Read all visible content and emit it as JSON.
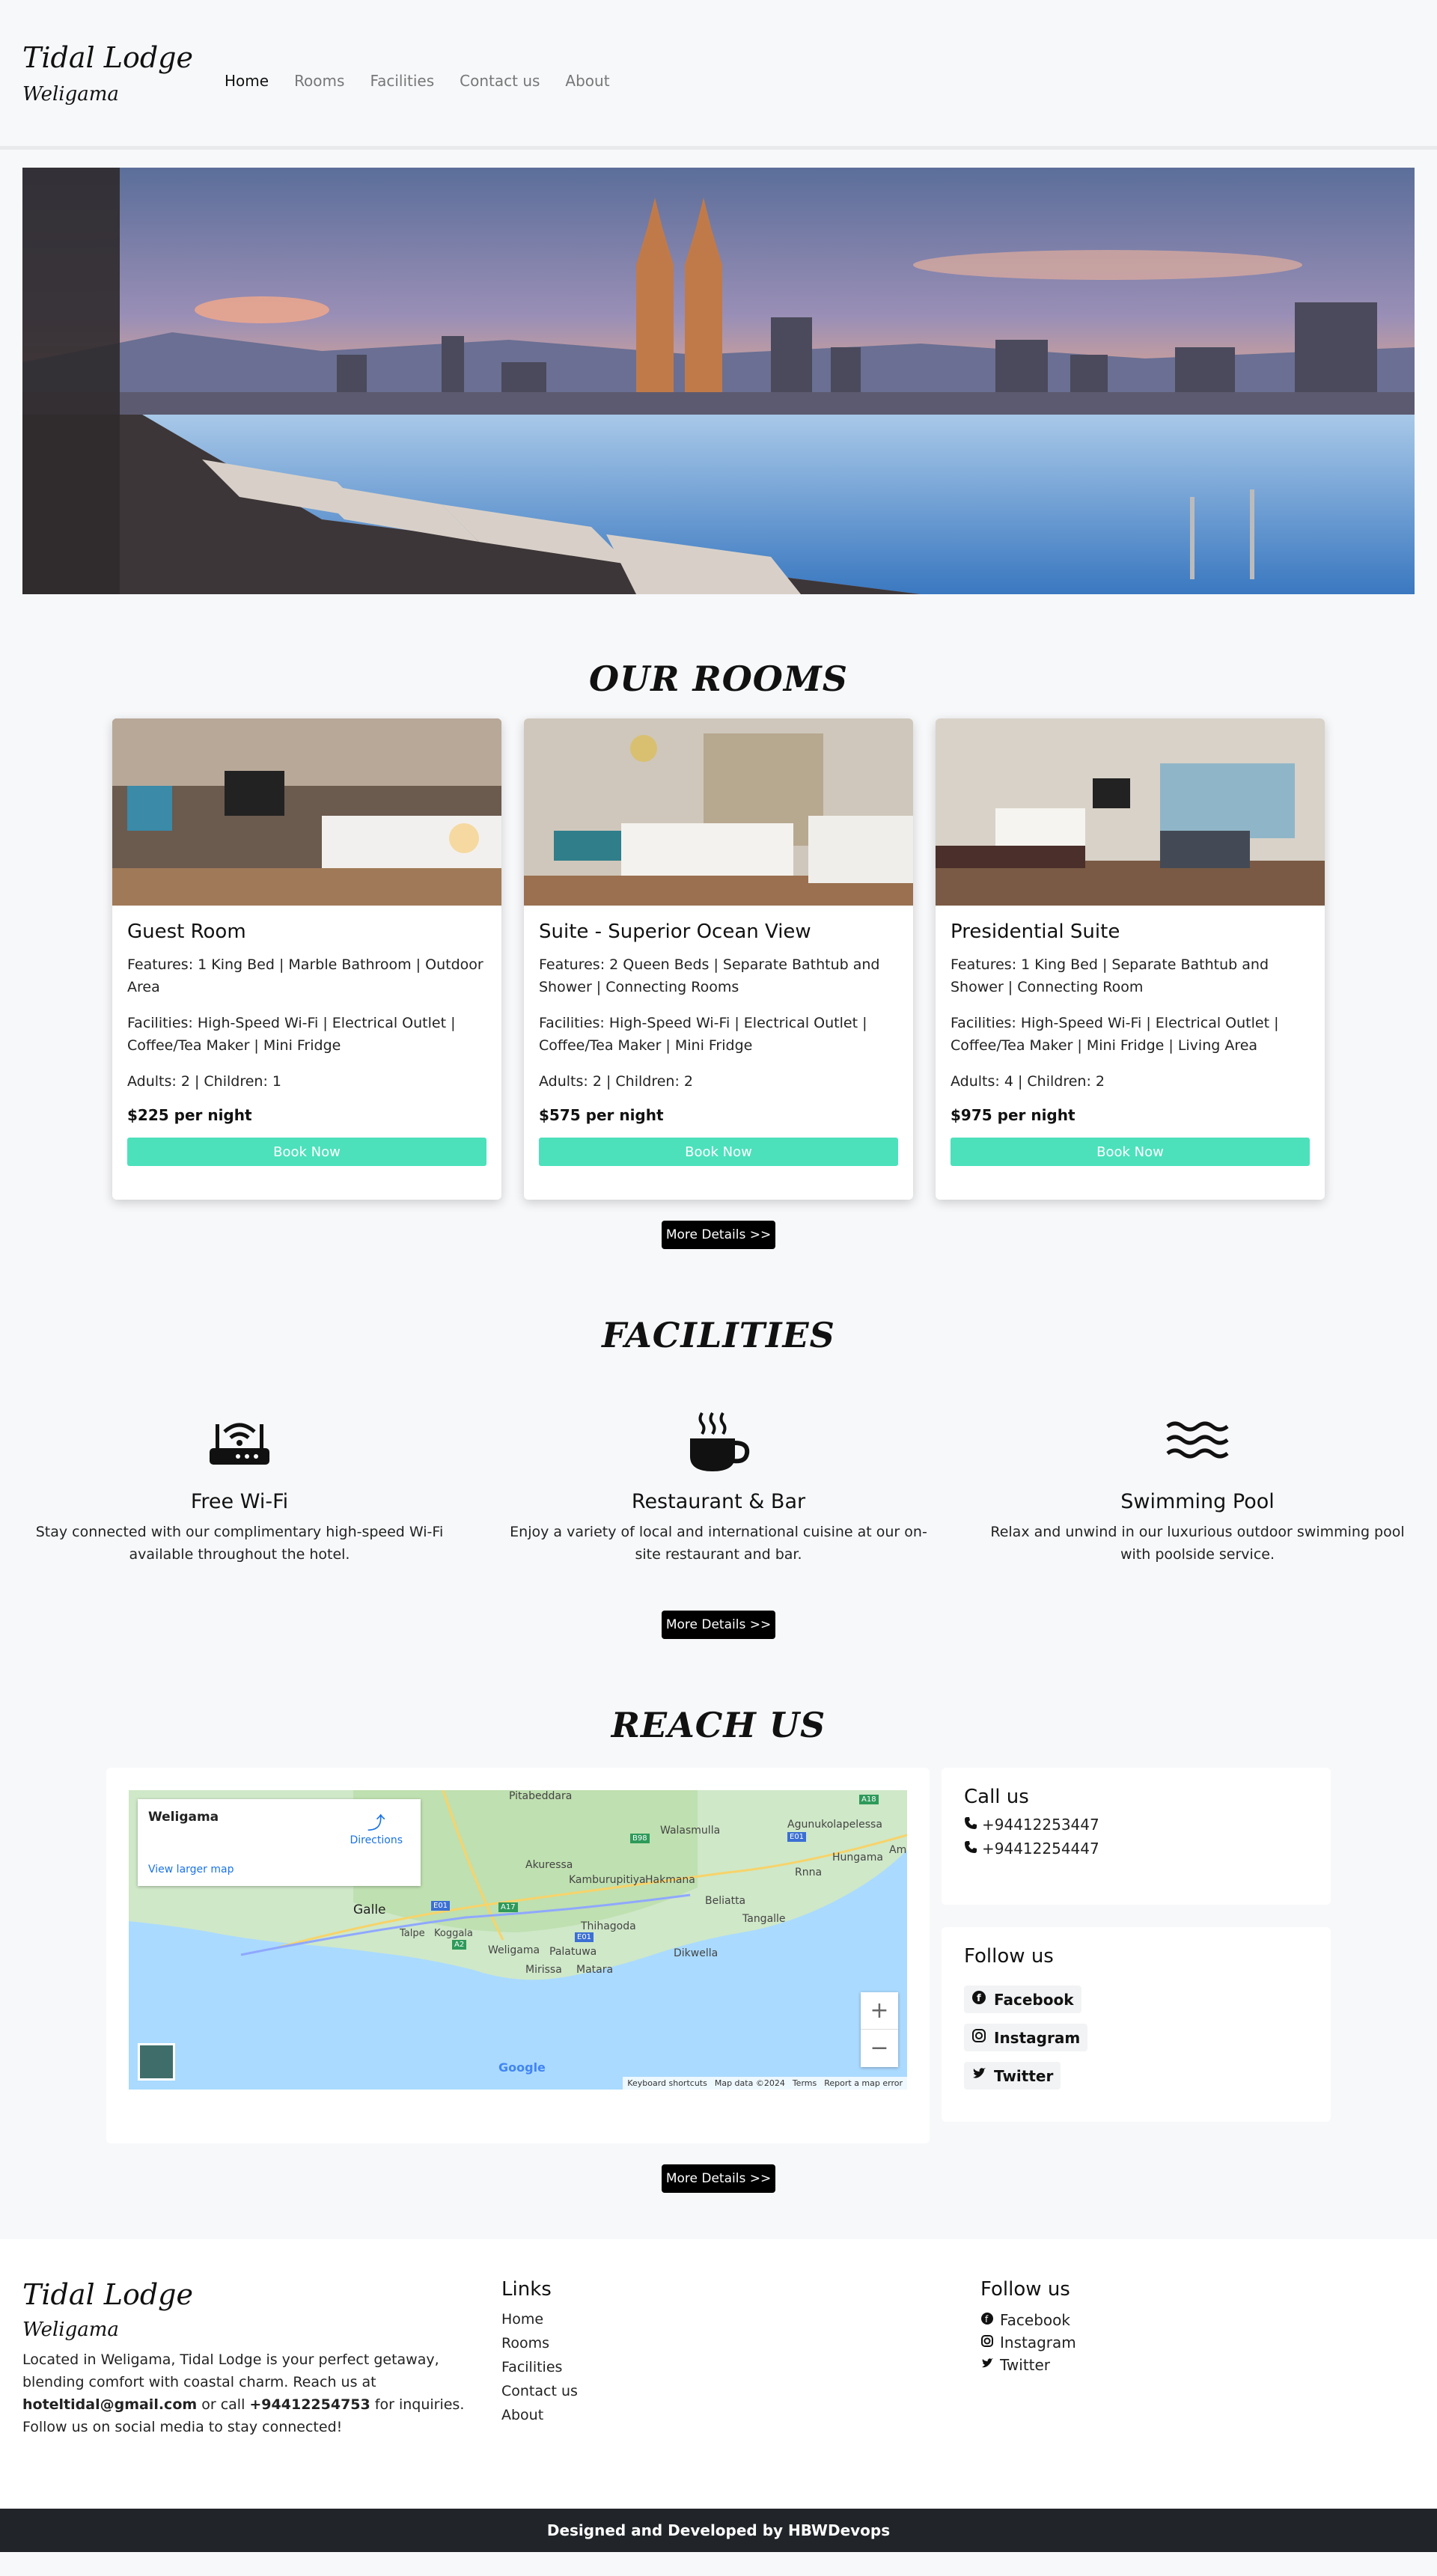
{
  "brand": {
    "name": "Tidal Lodge",
    "location": "Weligama"
  },
  "nav": [
    {
      "label": "Home",
      "active": true
    },
    {
      "label": "Rooms"
    },
    {
      "label": "Facilities"
    },
    {
      "label": "Contact us"
    },
    {
      "label": "About"
    }
  ],
  "rooms": {
    "title": "OUR ROOMS",
    "cards": [
      {
        "name": "Guest Room",
        "features": "Features: 1 King Bed | Marble Bathroom | Outdoor Area",
        "facilities": "Facilities: High-Speed Wi-Fi | Electrical Outlet | Coffee/Tea Maker | Mini Fridge",
        "occupancy": "Adults: 2 | Children: 1",
        "price": "$225 per night",
        "button": "Book Now"
      },
      {
        "name": "Suite - Superior Ocean View",
        "features": "Features: 2 Queen Beds | Separate Bathtub and Shower | Connecting Rooms",
        "facilities": "Facilities: High-Speed Wi-Fi | Electrical Outlet | Coffee/Tea Maker | Mini Fridge",
        "occupancy": "Adults: 2 | Children: 2",
        "price": "$575 per night",
        "button": "Book Now"
      },
      {
        "name": "Presidential Suite",
        "features": "Features: 1 King Bed | Separate Bathtub and Shower | Connecting Room",
        "facilities": "Facilities: High-Speed Wi-Fi | Electrical Outlet | Coffee/Tea Maker | Mini Fridge | Living Area",
        "occupancy": "Adults: 4 | Children: 2",
        "price": "$975 per night",
        "button": "Book Now"
      }
    ],
    "more": "More Details >>"
  },
  "facilities": {
    "title": "FACILITIES",
    "items": [
      {
        "name": "Free Wi-Fi",
        "desc": "Stay connected with our complimentary high-speed Wi-Fi available throughout the hotel.",
        "icon": "router-icon"
      },
      {
        "name": "Restaurant & Bar",
        "desc": "Enjoy a variety of local and international cuisine at our on-site restaurant and bar.",
        "icon": "coffee-cup-icon"
      },
      {
        "name": "Swimming Pool",
        "desc": "Relax and unwind in our luxurious outdoor swimming pool with poolside service.",
        "icon": "water-waves-icon"
      }
    ],
    "more": "More Details >>"
  },
  "reach": {
    "title": "REACH US",
    "map": {
      "place": "Weligama",
      "directions": "Directions",
      "larger": "View larger map",
      "labels": [
        "Pitabeddara",
        "Agunukolapelessa",
        "Walasmulla",
        "Hungama",
        "Ambal",
        "Akuressa",
        "Kamburupitiya",
        "Hakmana",
        "Rnna",
        "Galle",
        "Beliatta",
        "Tangalle",
        "Thihagoda",
        "Talpe",
        "Koggala",
        "Weligama",
        "Palatuwa",
        "Dikwella",
        "Mirissa",
        "Matara"
      ],
      "road_badges": [
        "A18",
        "B98",
        "E01",
        "A17",
        "E01",
        "A2",
        "E01"
      ],
      "zoom_in": "+",
      "zoom_out": "−",
      "google": "Google",
      "footer_items": [
        "Keyboard shortcuts",
        "Map data ©2024",
        "Terms",
        "Report a map error"
      ]
    },
    "call": {
      "title": "Call us",
      "phones": [
        "+94412253447",
        "+94412254447"
      ]
    },
    "follow": {
      "title": "Follow us",
      "items": [
        "Facebook",
        "Instagram",
        "Twitter"
      ]
    },
    "more": "More Details >>"
  },
  "footer": {
    "brand": "Tidal Lodge",
    "location": "Weligama",
    "about_1": "Located in Weligama, Tidal Lodge is your perfect getaway, blending comfort with coastal charm. Reach us at",
    "email": "hoteltidal@gmail.com",
    "about_2": "or call",
    "phone": "+94412254753",
    "about_3": "for inquiries. Follow us on social media to stay connected!",
    "links_title": "Links",
    "links": [
      "Home",
      "Rooms",
      "Facilities",
      "Contact us",
      "About"
    ],
    "follow_title": "Follow us",
    "follow": [
      "Facebook",
      "Instagram",
      "Twitter"
    ]
  },
  "copyright": "Designed and Developed by HBWDevops",
  "colors": {
    "accent": "#4ce1bb",
    "dark": "#212529"
  }
}
